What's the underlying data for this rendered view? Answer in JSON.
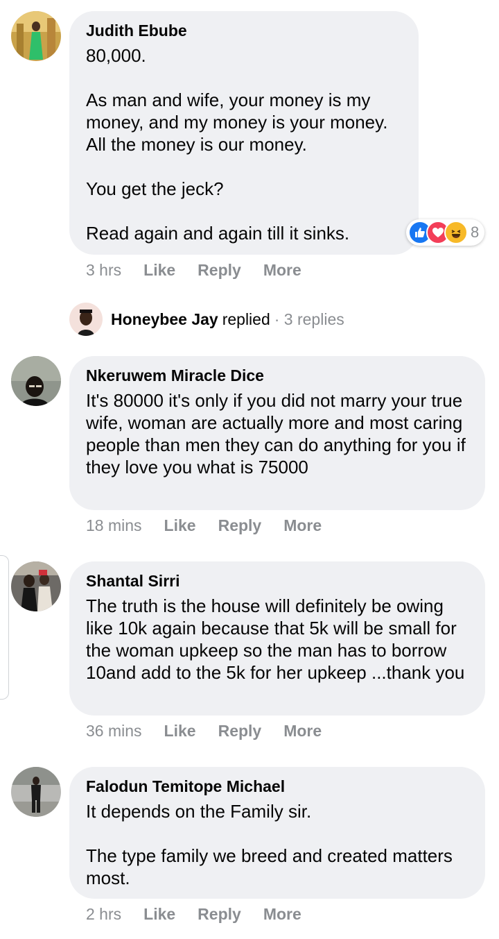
{
  "comments": [
    {
      "name": "Judith Ebube",
      "text": "80,000.\n\nAs man and wife, your money is my money, and my money is your money. All the money is our money.\n\nYou get the jeck?\n\nRead again and again till it sinks.",
      "time": "3 hrs",
      "like": "Like",
      "reply": "Reply",
      "more": "More",
      "reaction_count": "8"
    },
    {
      "name": "Nkeruwem Miracle Dice",
      "text": "It's 80000 it's only if you did not marry your true wife, woman are actually more and most caring people than men they can do anything for you if they love you what is 75000",
      "time": "18 mins",
      "like": "Like",
      "reply": "Reply",
      "more": "More"
    },
    {
      "name": "Shantal Sirri",
      "text": "The truth is the house will definitely be owing like 10k again because that 5k will be small for the woman upkeep so the man has to borrow 10and add to the 5k for her upkeep ...thank you",
      "time": "36 mins",
      "like": "Like",
      "reply": "Reply",
      "more": "More"
    },
    {
      "name": "Falodun Temitope Michael",
      "text": "It depends on the Family sir.\n\nThe type family we breed and created matters most.",
      "time": "2 hrs",
      "like": "Like",
      "reply": "Reply",
      "more": "More"
    }
  ],
  "replied": {
    "name": "Honeybee Jay",
    "verb": "replied",
    "count": "· 3 replies"
  },
  "colors": {
    "bubble": "#eff0f3",
    "meta": "#8a8d91",
    "like_blue": "#1877f2",
    "love_red": "#f33e58",
    "haha_yellow": "#f7b928"
  }
}
